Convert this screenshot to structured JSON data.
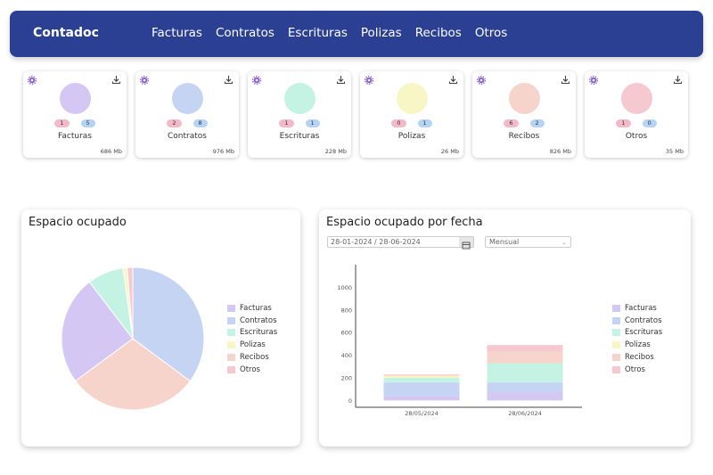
{
  "brand": "Contadoc",
  "nav": [
    "Facturas",
    "Contratos",
    "Escrituras",
    "Polizas",
    "Recibos",
    "Otros"
  ],
  "categories": [
    {
      "name": "Facturas",
      "color": "#d5c7f4",
      "badge_pink": "1",
      "badge_blue": "5",
      "size": "686 Mb"
    },
    {
      "name": "Contratos",
      "color": "#c6d4f4",
      "badge_pink": "2",
      "badge_blue": "8",
      "size": "976 Mb"
    },
    {
      "name": "Escrituras",
      "color": "#c5f3e3",
      "badge_pink": "1",
      "badge_blue": "1",
      "size": "228 Mb"
    },
    {
      "name": "Polizas",
      "color": "#f8f6c4",
      "badge_pink": "0",
      "badge_blue": "1",
      "size": "26 Mb"
    },
    {
      "name": "Recibos",
      "color": "#f6d3cb",
      "badge_pink": "6",
      "badge_blue": "2",
      "size": "826 Mb"
    },
    {
      "name": "Otros",
      "color": "#f6c8cf",
      "badge_pink": "1",
      "badge_blue": "0",
      "size": "35 Mb"
    }
  ],
  "panels": {
    "space_title": "Espacio ocupado",
    "date_title": "Espacio ocupado por fecha",
    "date_range": "28-01-2024 / 28-06-2024",
    "period": "Mensual"
  },
  "chart_data": [
    {
      "type": "pie",
      "categories": [
        "Facturas",
        "Contratos",
        "Escrituras",
        "Polizas",
        "Recibos",
        "Otros"
      ],
      "values": [
        686,
        976,
        228,
        26,
        826,
        35
      ],
      "legend": "right"
    },
    {
      "type": "bar",
      "stacked": true,
      "categories": [
        "28/05/2024",
        "28/06/2024"
      ],
      "series": [
        {
          "name": "Facturas",
          "values": [
            40,
            70
          ]
        },
        {
          "name": "Contratos",
          "values": [
            120,
            90
          ]
        },
        {
          "name": "Escrituras",
          "values": [
            40,
            170
          ]
        },
        {
          "name": "Polizas",
          "values": [
            20,
            0
          ]
        },
        {
          "name": "Recibos",
          "values": [
            0,
            110
          ]
        },
        {
          "name": "Otros",
          "values": [
            10,
            50
          ]
        }
      ],
      "yticks": [
        0,
        200,
        400,
        600,
        800,
        1000
      ],
      "ylim": [
        -60,
        1200
      ],
      "legend": "right"
    }
  ]
}
